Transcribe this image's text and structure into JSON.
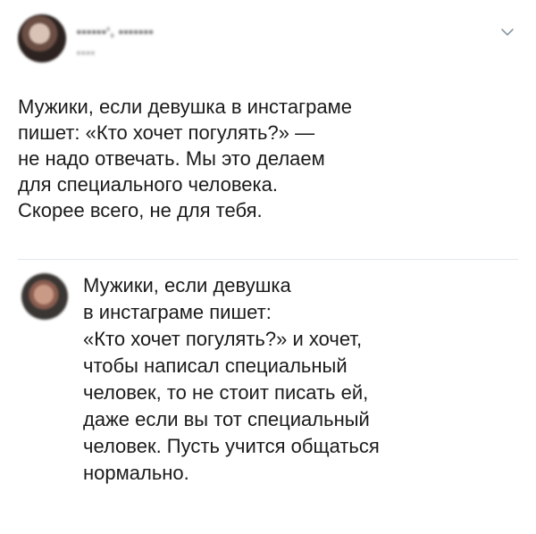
{
  "tweet": {
    "author_name_blurred": "▪▪▪▪▪▪', ▪▪▪▪▪▪▪",
    "author_handle_blurred": "▪▪▪▪",
    "avatar_icon": "avatar-icon",
    "menu_icon": "chevron-down-icon",
    "text": "Мужики, если девушка в инстаграме\nпишет: «Кто хочет погулять?» —\nне надо отвечать. Мы это делаем\nдля специального человека.\nСкорее всего, не для тебя."
  },
  "reply": {
    "avatar_icon": "avatar-icon",
    "text": "Мужики, если девушка\nв инстаграме пишет:\n«Кто хочет погулять?» и хочет,\nчтобы написал специальный\nчеловек, то не стоит писать ей,\nдаже если вы тот специальный\nчеловек. Пусть учится общаться\nнормально."
  },
  "colors": {
    "text": "#1b1b1b",
    "divider": "#e1e8ed",
    "chevron": "#8899a6"
  }
}
